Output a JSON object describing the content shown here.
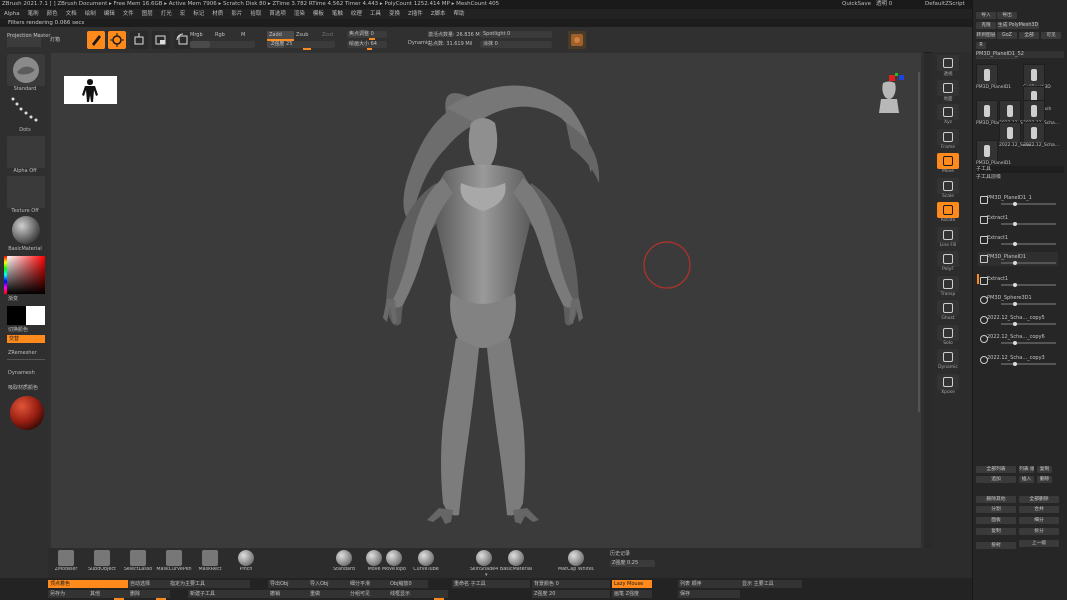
{
  "titlebar": {
    "text": "ZBrush 2021.7.1 [ ]  ZBrush Document  ▸ Free Mem 16.6GB ▸ Active Mem 7906 ▸ Scratch Disk 80 ▸ ZTime 3.782 RTime 4.562 Timer 4.443 ▸ PolyCount 1252.414 MP ▸ MeshCount 405",
    "quicksave": "QuickSave",
    "transparency": "透明 0",
    "script": "DefaultZScript"
  },
  "menubar": [
    "Alpha",
    "笔刷",
    "颜色",
    "文档",
    "绘制",
    "编辑",
    "文件",
    "图层",
    "灯光",
    "宏",
    "标记",
    "材质",
    "影片",
    "拾取",
    "首选项",
    "渲染",
    "模板",
    "笔触",
    "纹理",
    "工具",
    "变换",
    "Z插件",
    "Z脚本",
    "帮助"
  ],
  "infobar": "Filters rendering 0.066 secs",
  "toptool": {
    "projection": "Projection Master",
    "lightbox": "灯箱",
    "mrgb": "Mrgb",
    "rgb": "Rgb",
    "m": "M",
    "zadd": "Zadd",
    "zsub": "Zsub",
    "zcut": "Zcut",
    "rgb_intensity": "Z强度 25",
    "focal": "焦点调整 0",
    "draw_size": "绘画大小 64",
    "dynamic": "Dynamic",
    "active_points": "激活点数量: 26.836 Mil",
    "total_points": "总点数: 31.619 Mil",
    "spotlight": "Spotlight 0",
    "mask_label": "涂抹 0"
  },
  "lefttray": {
    "brush": "Standard",
    "stroke": "Dots",
    "alpha": "Alpha Off",
    "texture": "Texture Off",
    "material": "BasicMaterial",
    "gradient": "渐变",
    "switch_color": "切换颜色",
    "alternate": "交替",
    "zremesher": "ZRemesher",
    "dynamesh": "Dynamesh",
    "picker": "吸取材质颜色"
  },
  "righttray": [
    "透视",
    "地面",
    "Xyz",
    "Frame",
    "Move",
    "Scale",
    "Rotate",
    "Line Fill",
    "PolyF",
    "Transp",
    "Ghost",
    "Solo",
    "Dynamic",
    "Xpose"
  ],
  "rightpanel": {
    "header": [
      "导入",
      "导出",
      "克隆",
      "生成 PolyMesh3D",
      "转到图层",
      "GoZ",
      "全部",
      "可见",
      "R",
      "光源盒 › 工具"
    ],
    "current_tool": "PM3D_PlaneID1_52",
    "thumbs": [
      "PM3D_PlaneID1",
      "CoilBrush3D",
      "SimpleBrush",
      "PM3D_PlaneID1",
      "2022.12_Scha...",
      "2022.12_Scha...",
      "2022.12_Scha...",
      "2022.12_Scha...",
      "PM3D_PlaneID1"
    ],
    "subtool_header": "子工具",
    "subtool_label": "子工具层级",
    "subtools": [
      "PM3D_PlaneID1_1",
      "Extract1",
      "Extract1",
      "PM3D_PlaneID1",
      "Extract1",
      "PM3D_Sphere3D1",
      "2022.12_Scha..._copy5",
      "2022.12_Scha..._copy6",
      "2022.12_Scha..._copy3"
    ],
    "lower": [
      "全部列表",
      "列表 顺序",
      "复制",
      "追加",
      "插入",
      "删除",
      "删除其他",
      "全部删除",
      "分割",
      "合并",
      "面板",
      "细分",
      "复制",
      "拆分",
      "投射",
      "上一级"
    ]
  },
  "bottomshelf": {
    "items": [
      "ZModeler",
      "SubdObject",
      "SelectLasso",
      "MaskCurvePen",
      "MaskRect",
      "Pinch",
      "Standard",
      "Move",
      "MoveTopo",
      "CurveTube",
      "SkinShade4",
      "BasicMaterial",
      "MatCap White01"
    ],
    "extra": "历史记录",
    "zintensity": "Z强度 0.25"
  },
  "bottombar": {
    "r1": [
      "顶点着色",
      "自动选择",
      "指定为主要工具",
      "导出Obj",
      "导入Obj",
      "细分平滑",
      "Obj缩放0",
      "重命名 子工具",
      "背景颜色 0",
      "Lazy Mouse",
      "列表 顺序",
      "显示 主要工具"
    ],
    "r2": [
      "另存为",
      "其他",
      "删除",
      "新建子工具",
      "撤销",
      "重做",
      "分组可见",
      "线框显示",
      "Z强度 20",
      "画笔 Z强度",
      "保存"
    ]
  }
}
